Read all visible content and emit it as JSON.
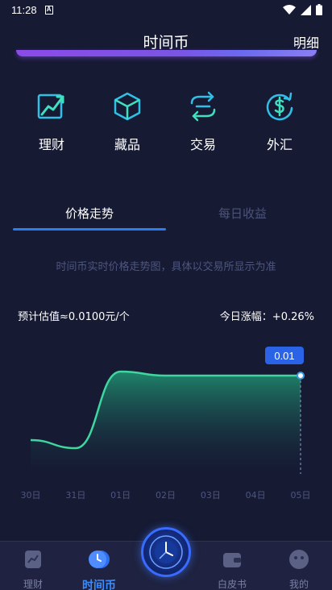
{
  "status_bar": {
    "time": "11:28",
    "a_badge": "A"
  },
  "header": {
    "title": "时间币",
    "detail_link": "明细"
  },
  "features": [
    {
      "label": "理财",
      "icon": "chart-trend-icon"
    },
    {
      "label": "藏品",
      "icon": "cube-icon"
    },
    {
      "label": "交易",
      "icon": "exchange-arrows-icon"
    },
    {
      "label": "外汇",
      "icon": "dollar-cycle-icon"
    }
  ],
  "tabs": {
    "active": "价格走势",
    "inactive": "每日收益"
  },
  "chart_description": "时间币实时价格走势图，具体以交易所显示为准",
  "stats": {
    "estimate": "预计估值≈0.0100元/个",
    "change": "今日涨幅：+0.26%"
  },
  "chart_data": {
    "type": "area",
    "categories": [
      "30日",
      "31日",
      "01日",
      "02日",
      "03日",
      "04日",
      "05日"
    ],
    "values": [
      0.0092,
      0.0091,
      0.01005,
      0.01,
      0.01,
      0.01,
      0.01
    ],
    "tooltip_value": "0.01",
    "colors": {
      "line": "#3fd6a0",
      "fill_top": "#1f8a6e",
      "fill_bottom": "#161a33"
    }
  },
  "bottom_nav": {
    "items": [
      {
        "label": "理财",
        "icon": "finance-icon"
      },
      {
        "label": "时间币",
        "icon": "clock-coin-icon"
      },
      {
        "label": "白皮书",
        "icon": "wallet-icon"
      },
      {
        "label": "我的",
        "icon": "profile-icon"
      }
    ],
    "center_icon": "compass-clock-icon"
  },
  "colors": {
    "background": "#161a33",
    "accent": "#2a7df0",
    "title_bar": "#8b4be8",
    "tooltip": "#2a63e6"
  }
}
